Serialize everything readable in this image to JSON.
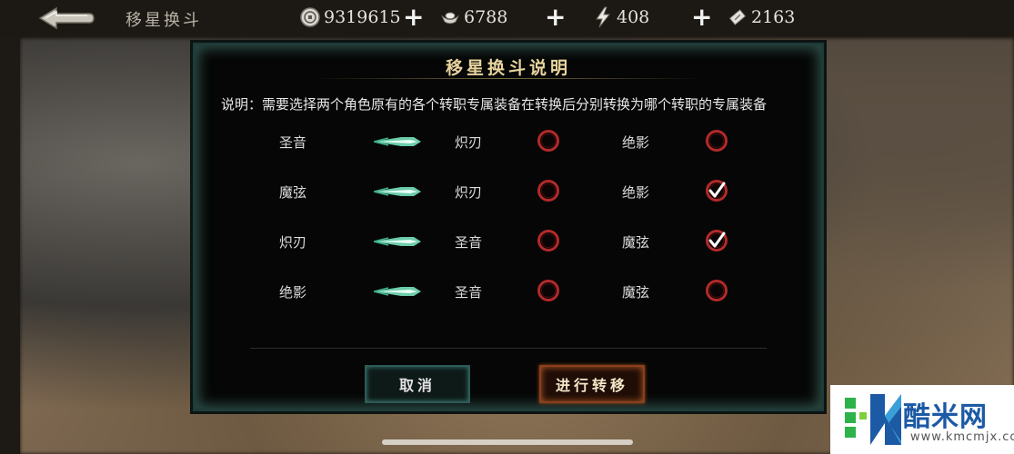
{
  "header": {
    "title": "移星换斗",
    "resources": [
      {
        "icon": "coin-icon",
        "value": "9319615"
      },
      {
        "icon": "silver-ingot-icon",
        "value": "6788"
      },
      {
        "icon": "stamina-lightning-icon",
        "value": "408"
      },
      {
        "icon": "ticket-icon",
        "value": "2163"
      }
    ]
  },
  "dialog": {
    "title": "移星换斗说明",
    "description": "说明：需要选择两个角色原有的各个转职专属装备在转换后分别转换为哪个转职的专属装备",
    "rows": [
      {
        "from": "圣音",
        "option_a": "炽刃",
        "option_a_checked": false,
        "option_b": "绝影",
        "option_b_checked": false
      },
      {
        "from": "魔弦",
        "option_a": "炽刃",
        "option_a_checked": false,
        "option_b": "绝影",
        "option_b_checked": true
      },
      {
        "from": "炽刃",
        "option_a": "圣音",
        "option_a_checked": false,
        "option_b": "魔弦",
        "option_b_checked": true
      },
      {
        "from": "绝影",
        "option_a": "圣音",
        "option_a_checked": false,
        "option_b": "魔弦",
        "option_b_checked": false
      }
    ],
    "cancel_label": "取消",
    "confirm_label": "进行转移"
  },
  "watermark": {
    "name": "酷米网",
    "url": "www.kmcmjx.com"
  },
  "colors": {
    "accent_gold": "#e8d49e",
    "circle_red": "#b22a2a",
    "arrow_green": "#7ff0c8",
    "logo_blue": "#1c5aa5"
  }
}
